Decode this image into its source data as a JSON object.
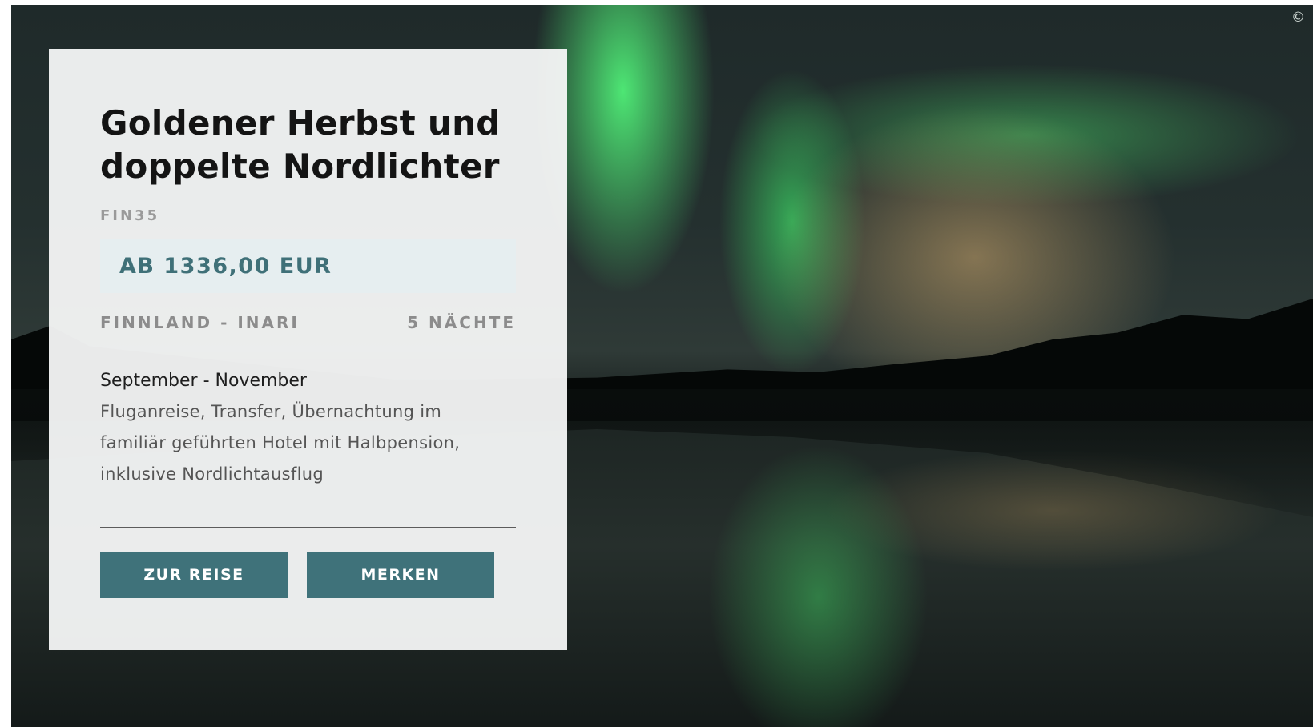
{
  "hero": {
    "copyright_symbol": "©"
  },
  "card": {
    "title": "Goldener Herbst und doppelte Nordlichter",
    "code": "FIN35",
    "price": "AB 1336,00 EUR",
    "destination": "FINNLAND - INARI",
    "nights": "5 NÄCHTE",
    "season": "September - November",
    "description": "Fluganreise, Transfer, Übernachtung im familiär geführten Hotel mit Halbpension, inklusive Nordlichtausflug",
    "buttons": {
      "trip_label": "ZUR REISE",
      "save_label": "MERKEN"
    }
  },
  "colors": {
    "accent": "#3f727a",
    "price_text": "#3f7078",
    "price_bg": "#e6eef0"
  }
}
